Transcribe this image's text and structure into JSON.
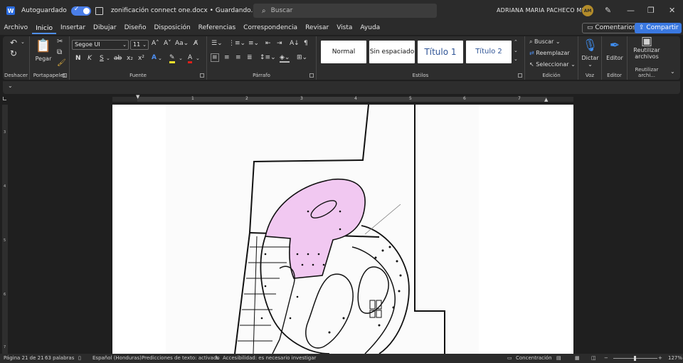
{
  "titlebar": {
    "autosave_label": "Autoguardado",
    "document_title": "zonificación connect one.docx • Guardando...",
    "search_placeholder": "Buscar",
    "user_name": "ADRIANA MARIA PACHECO MEJIA",
    "user_initials": "AM"
  },
  "menu": {
    "items": [
      "Archivo",
      "Inicio",
      "Insertar",
      "Dibujar",
      "Diseño",
      "Disposición",
      "Referencias",
      "Correspondencia",
      "Revisar",
      "Vista",
      "Ayuda"
    ],
    "active": "Inicio",
    "comments_label": "Comentarios",
    "share_label": "Compartir"
  },
  "ribbon": {
    "undo_label": "Deshacer",
    "clipboard": {
      "paste_label": "Pegar",
      "group_label": "Portapapeles"
    },
    "font": {
      "name": "Segoe UI",
      "size": "11",
      "group_label": "Fuente"
    },
    "paragraph": {
      "group_label": "Párrafo"
    },
    "styles": {
      "items": [
        "Normal",
        "Sin espaciado",
        "Título 1",
        "Título 2"
      ],
      "group_label": "Estilos"
    },
    "editing": {
      "find_label": "Buscar",
      "replace_label": "Reemplazar",
      "select_label": "Seleccionar",
      "group_label": "Edición"
    },
    "voice": {
      "dictate_label": "Dictar",
      "group_label": "Voz"
    },
    "editor": {
      "editor_label": "Editor",
      "group_label": "Editor"
    },
    "reuse": {
      "label_line1": "Reutilizar",
      "label_line2": "archivos",
      "group_label": "Reutilizar archi..."
    }
  },
  "ruler": {
    "numbers": [
      "1",
      "2",
      "3",
      "4",
      "5",
      "6",
      "7"
    ]
  },
  "vruler": {
    "numbers": [
      "3",
      "4",
      "5",
      "6",
      "7"
    ]
  },
  "status": {
    "page": "Página 21 de 21",
    "words": "63 palabras",
    "language": "Español (Honduras)",
    "predictions": "Predicciones de texto: activado",
    "accessibility": "Accesibilidad: es necesario investigar",
    "focus": "Concentración",
    "zoom": "127%"
  },
  "colors": {
    "accent": "#3a78e0",
    "zone_fill": "#f1c8f1"
  }
}
